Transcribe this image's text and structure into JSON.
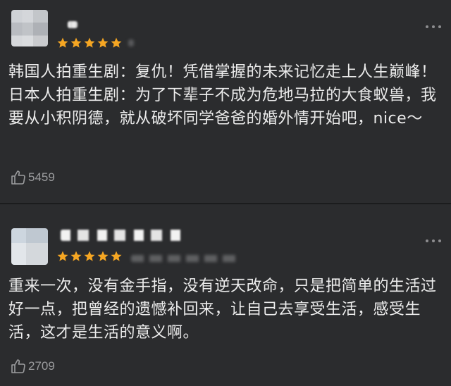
{
  "reviews": [
    {
      "stars": 5,
      "text": "韩国人拍重生剧：复仇！凭借掌握的未来记忆走上人生巅峰！日本人拍重生剧：为了下辈子不成为危地马拉的大食蚁兽，我要从小积阴德，就从破坏同学爸爸的婚外情开始吧，nice～",
      "likes": "5459",
      "icons": {
        "avatar": "avatar-blurred",
        "more": "more-dots-icon",
        "like": "thumbs-up-icon"
      }
    },
    {
      "stars": 5,
      "text": "重来一次，没有金手指，没有逆天改命，只是把简单的生活过好一点，把曾经的遗憾补回来，让自己去享受生活，感受生活，这才是生活的意义啊。",
      "likes": "2709",
      "icons": {
        "avatar": "avatar-blurred",
        "more": "more-dots-icon",
        "like": "thumbs-up-icon"
      }
    }
  ],
  "colors": {
    "background": "#2b2c2e",
    "star": "#f5a623",
    "text": "#ececec",
    "muted": "#9b9c9e"
  }
}
